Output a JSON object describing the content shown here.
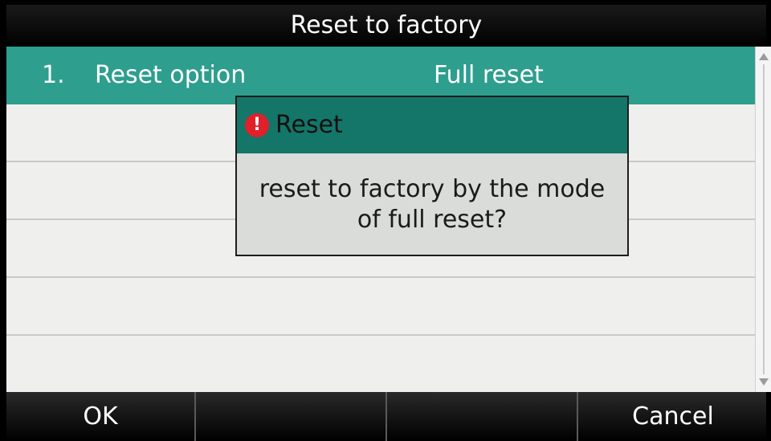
{
  "title": "Reset to factory",
  "list": {
    "rows": [
      {
        "index": "1.",
        "label": "Reset option",
        "value": "Full reset"
      }
    ]
  },
  "dialog": {
    "icon": "alert-icon",
    "icon_glyph": "!",
    "title": "Reset",
    "message_line1": "reset to factory by the mode",
    "message_line2": "of full reset?"
  },
  "softkeys": {
    "ok": "OK",
    "key2": "",
    "key3": "",
    "cancel": "Cancel"
  },
  "colors": {
    "selected_row": "#2e9e8e",
    "dialog_header": "#147668",
    "alert": "#e0202a"
  }
}
